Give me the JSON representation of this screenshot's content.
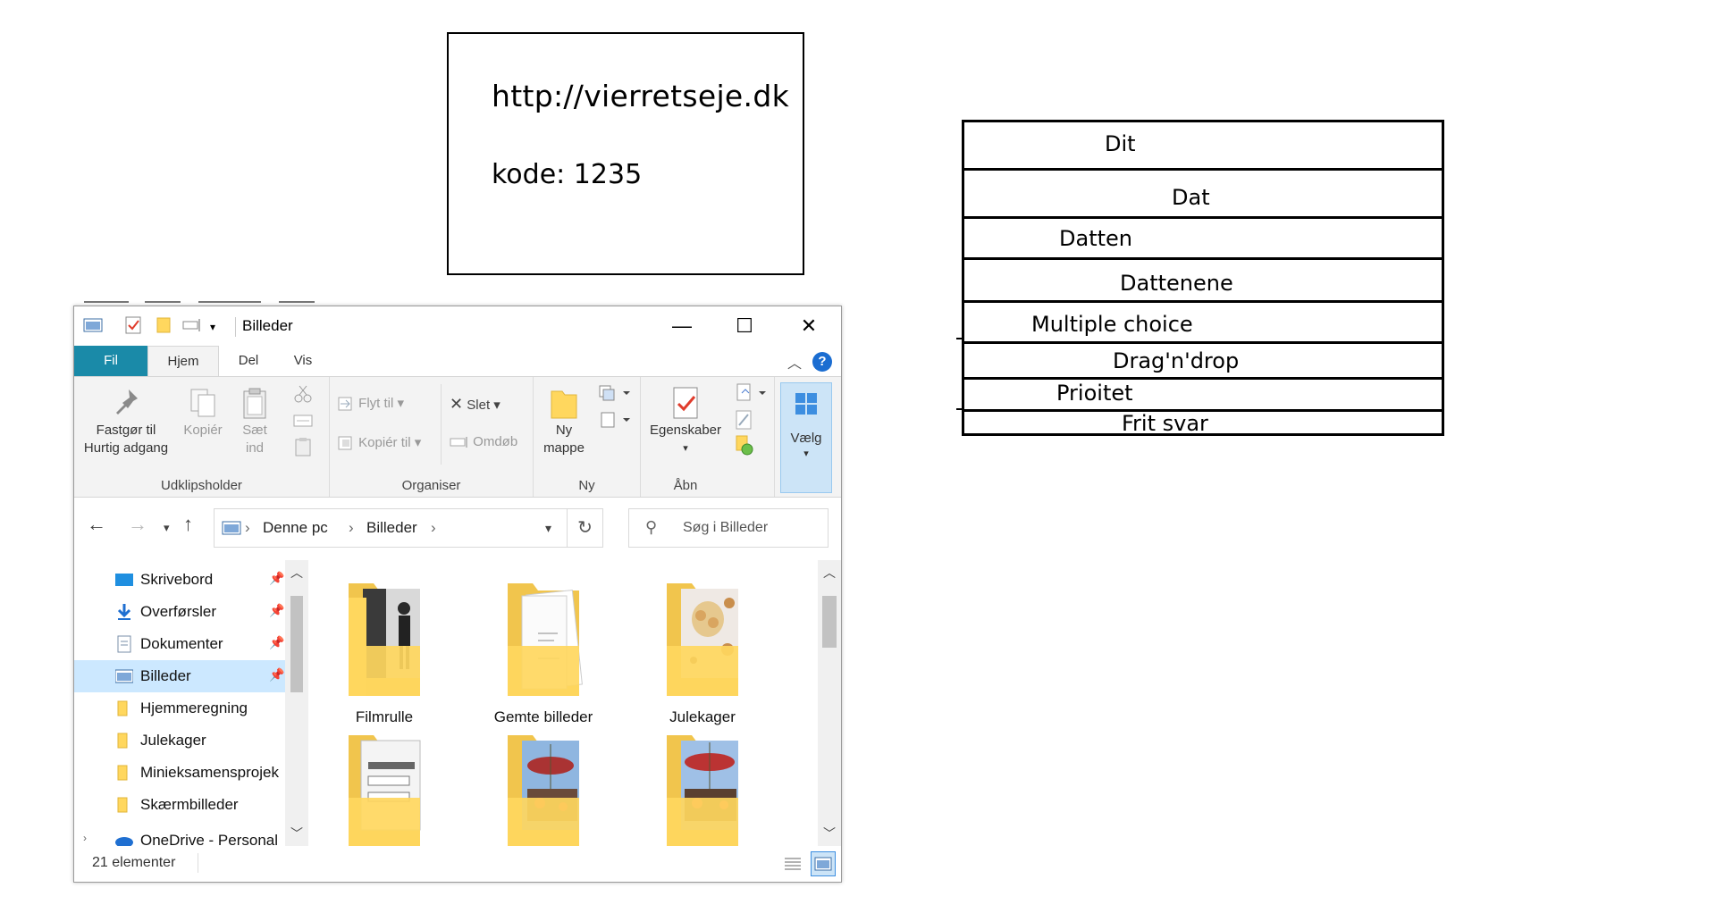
{
  "info_box": {
    "url": "http://vierretseje.dk",
    "code": "kode: 1235"
  },
  "options": [
    "Dit",
    "Dat",
    "Datten",
    "Dattenene",
    "Multiple choice",
    "Drag'n'drop",
    "Prioitet",
    "Frit svar"
  ],
  "explorer": {
    "title": "Billeder",
    "tabs": {
      "fil": "Fil",
      "hjem": "Hjem",
      "del": "Del",
      "vis": "Vis"
    },
    "help": "?",
    "ribbon": {
      "pin_label_1": "Fastgør til",
      "pin_label_2": "Hurtig adgang",
      "copy": "Kopiér",
      "paste_1": "Sæt",
      "paste_2": "ind",
      "clipboard_group": "Udklipsholder",
      "move_to": "Flyt til",
      "copy_to": "Kopiér til",
      "delete": "Slet",
      "rename": "Omdøb",
      "organize_group": "Organiser",
      "new_folder_1": "Ny",
      "new_folder_2": "mappe",
      "new_group": "Ny",
      "properties": "Egenskaber",
      "open_group": "Åbn",
      "select": "Vælg"
    },
    "address": {
      "root": "Denne pc",
      "folder": "Billeder"
    },
    "search_placeholder": "Søg i Billeder",
    "nav": [
      {
        "label": "Skrivebord",
        "icon": "desktop-icon",
        "pinned": true
      },
      {
        "label": "Overførsler",
        "icon": "download-icon",
        "pinned": true
      },
      {
        "label": "Dokumenter",
        "icon": "document-icon",
        "pinned": true
      },
      {
        "label": "Billeder",
        "icon": "pictures-icon",
        "pinned": true,
        "selected": true
      },
      {
        "label": "Hjemmeregning",
        "icon": "folder-icon"
      },
      {
        "label": "Julekager",
        "icon": "folder-icon"
      },
      {
        "label": "Minieksamensprojek",
        "icon": "folder-icon"
      },
      {
        "label": "Skærmbilleder",
        "icon": "folder-icon"
      },
      {
        "label": "OneDrive - Personal",
        "icon": "onedrive-icon"
      }
    ],
    "folders": [
      {
        "label": "Filmrulle"
      },
      {
        "label": "Gemte billeder"
      },
      {
        "label": "Julekager"
      },
      {
        "label": ""
      },
      {
        "label": ""
      },
      {
        "label": ""
      }
    ],
    "status": "21 elementer"
  },
  "colors": {
    "fil_tab": "#1a8aa8",
    "selected": "#cce8ff",
    "folder": "#ffd75e",
    "accent": "#1b6dd1"
  }
}
